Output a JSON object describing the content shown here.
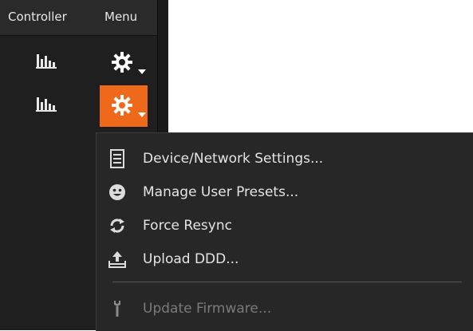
{
  "header": {
    "controller_label": "Controller",
    "menu_label": "Menu"
  },
  "rows": [
    {
      "eq_icon": "equalizer-icon",
      "gear_icon": "gear-icon",
      "active": false
    },
    {
      "eq_icon": "equalizer-icon",
      "gear_icon": "gear-icon",
      "active": true
    }
  ],
  "menu": {
    "items": [
      {
        "label": "Device/Network Settings...",
        "icon": "document-icon",
        "enabled": true
      },
      {
        "label": "Manage User Presets...",
        "icon": "smiley-icon",
        "enabled": true
      },
      {
        "label": "Force Resync",
        "icon": "resync-icon",
        "enabled": true
      },
      {
        "label": "Upload DDD...",
        "icon": "upload-icon",
        "enabled": true
      },
      {
        "label": "Update Firmware...",
        "icon": "wrench-icon",
        "enabled": false
      }
    ]
  },
  "colors": {
    "accent": "#ee6a1a",
    "panel_bg": "#1f1f1f",
    "menu_bg": "#272727"
  }
}
